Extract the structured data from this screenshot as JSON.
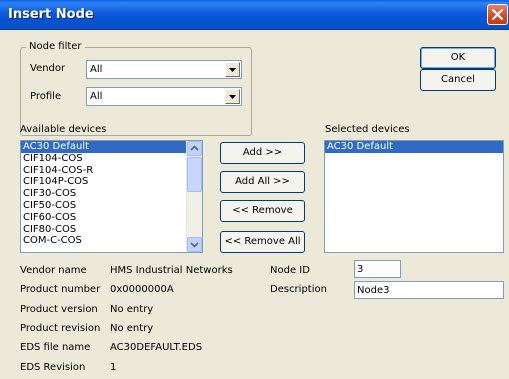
{
  "window": {
    "title": "Insert Node"
  },
  "node_filter": {
    "label": "Node filter",
    "vendor_label": "Vendor",
    "vendor_value": "All",
    "profile_label": "Profile",
    "profile_value": "All"
  },
  "buttons": {
    "ok": "OK",
    "cancel": "Cancel",
    "add": "Add >>",
    "add_all": "Add All >>",
    "remove": "<< Remove",
    "remove_all": "<< Remove All"
  },
  "available": {
    "label": "Available devices",
    "items": [
      "AC30 Default",
      "CIF104-COS",
      "CIF104-COS-R",
      "CIF104P-COS",
      "CIF30-COS",
      "CIF50-COS",
      "CIF60-COS",
      "CIF80-COS",
      "COM-C-COS"
    ],
    "selected_index": 0
  },
  "selected": {
    "label": "Selected devices",
    "items": [
      "AC30 Default"
    ]
  },
  "details": {
    "vendor_name_label": "Vendor name",
    "vendor_name_value": "HMS Industrial Networks",
    "product_number_label": "Product number",
    "product_number_value": "0x0000000A",
    "product_version_label": "Product version",
    "product_version_value": "No entry",
    "product_revision_label": "Product revision",
    "product_revision_value": "No entry",
    "eds_file_label": "EDS file name",
    "eds_file_value": "AC30DEFAULT.EDS",
    "eds_revision_label": "EDS Revision",
    "eds_revision_value": "1",
    "node_id_label": "Node ID",
    "node_id_value": "3",
    "description_label": "Description",
    "description_value": "Node3"
  },
  "colors": {
    "titlebar": "#0a5fe0",
    "dialog_bg": "#ece9d8",
    "selection": "#316ac5"
  },
  "icons": {
    "close": "close-icon",
    "dropdown": "chevron-down-icon",
    "scroll_up": "scroll-up-icon",
    "scroll_down": "scroll-down-icon"
  }
}
